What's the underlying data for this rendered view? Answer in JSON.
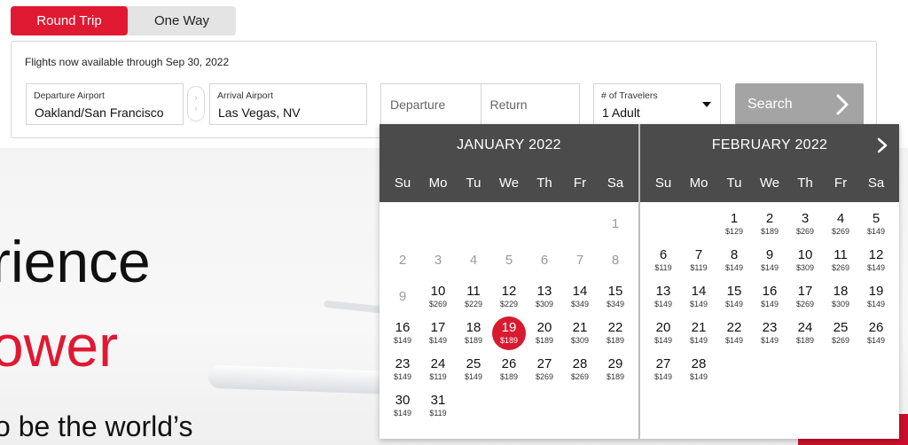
{
  "trip_type": {
    "round_trip": "Round Trip",
    "one_way": "One Way",
    "selected": "Round Trip"
  },
  "availability": "Flights now available through  Sep 30, 2022",
  "departure_airport": {
    "label": "Departure Airport",
    "value": "Oakland/San Francisco"
  },
  "arrival_airport": {
    "label": "Arrival Airport",
    "value": "Las Vegas, NV"
  },
  "dates": {
    "departure_placeholder": "Departure",
    "return_placeholder": "Return"
  },
  "travelers": {
    "label": "# of Travelers",
    "value": "1 Adult"
  },
  "search_button": "Search",
  "hero": {
    "line1": "rience",
    "line2": "ower",
    "line3": "o be the world’s"
  },
  "colors": {
    "accent": "#e01933",
    "calendar_header": "#4b4b4b",
    "search_button": "#a4a4a4"
  },
  "calendar": {
    "weekdays": [
      "Su",
      "Mo",
      "Tu",
      "We",
      "Th",
      "Fr",
      "Sa"
    ],
    "months": [
      {
        "title": "JANUARY  2022",
        "days": [
          {
            "d": "",
            "p": ""
          },
          {
            "d": "",
            "p": ""
          },
          {
            "d": "",
            "p": ""
          },
          {
            "d": "",
            "p": ""
          },
          {
            "d": "",
            "p": ""
          },
          {
            "d": "",
            "p": ""
          },
          {
            "d": "1",
            "p": "",
            "disabled": true
          },
          {
            "d": "2",
            "p": "",
            "disabled": true
          },
          {
            "d": "3",
            "p": "",
            "disabled": true
          },
          {
            "d": "4",
            "p": "",
            "disabled": true
          },
          {
            "d": "5",
            "p": "",
            "disabled": true
          },
          {
            "d": "6",
            "p": "",
            "disabled": true
          },
          {
            "d": "7",
            "p": "",
            "disabled": true
          },
          {
            "d": "8",
            "p": "",
            "disabled": true
          },
          {
            "d": "9",
            "p": "",
            "disabled": true
          },
          {
            "d": "10",
            "p": "$269"
          },
          {
            "d": "11",
            "p": "$229"
          },
          {
            "d": "12",
            "p": "$229"
          },
          {
            "d": "13",
            "p": "$309"
          },
          {
            "d": "14",
            "p": "$349"
          },
          {
            "d": "15",
            "p": "$349"
          },
          {
            "d": "16",
            "p": "$149"
          },
          {
            "d": "17",
            "p": "$149"
          },
          {
            "d": "18",
            "p": "$189"
          },
          {
            "d": "19",
            "p": "$189",
            "selected": true
          },
          {
            "d": "20",
            "p": "$189"
          },
          {
            "d": "21",
            "p": "$309"
          },
          {
            "d": "22",
            "p": "$189"
          },
          {
            "d": "23",
            "p": "$149"
          },
          {
            "d": "24",
            "p": "$119"
          },
          {
            "d": "25",
            "p": "$149"
          },
          {
            "d": "26",
            "p": "$189"
          },
          {
            "d": "27",
            "p": "$269"
          },
          {
            "d": "28",
            "p": "$269"
          },
          {
            "d": "29",
            "p": "$189"
          },
          {
            "d": "30",
            "p": "$149"
          },
          {
            "d": "31",
            "p": "$119"
          }
        ]
      },
      {
        "title": "FEBRUARY  2022",
        "days": [
          {
            "d": "",
            "p": ""
          },
          {
            "d": "",
            "p": ""
          },
          {
            "d": "1",
            "p": "$129"
          },
          {
            "d": "2",
            "p": "$189"
          },
          {
            "d": "3",
            "p": "$269"
          },
          {
            "d": "4",
            "p": "$269"
          },
          {
            "d": "5",
            "p": "$149"
          },
          {
            "d": "6",
            "p": "$119"
          },
          {
            "d": "7",
            "p": "$119"
          },
          {
            "d": "8",
            "p": "$149"
          },
          {
            "d": "9",
            "p": "$149"
          },
          {
            "d": "10",
            "p": "$309"
          },
          {
            "d": "11",
            "p": "$269"
          },
          {
            "d": "12",
            "p": "$149"
          },
          {
            "d": "13",
            "p": "$149"
          },
          {
            "d": "14",
            "p": "$149"
          },
          {
            "d": "15",
            "p": "$149"
          },
          {
            "d": "16",
            "p": "$149"
          },
          {
            "d": "17",
            "p": "$269"
          },
          {
            "d": "18",
            "p": "$309"
          },
          {
            "d": "19",
            "p": "$149"
          },
          {
            "d": "20",
            "p": "$149"
          },
          {
            "d": "21",
            "p": "$149"
          },
          {
            "d": "22",
            "p": "$149"
          },
          {
            "d": "23",
            "p": "$149"
          },
          {
            "d": "24",
            "p": "$189"
          },
          {
            "d": "25",
            "p": "$269"
          },
          {
            "d": "26",
            "p": "$149"
          },
          {
            "d": "27",
            "p": "$149"
          },
          {
            "d": "28",
            "p": "$149"
          }
        ]
      }
    ]
  }
}
